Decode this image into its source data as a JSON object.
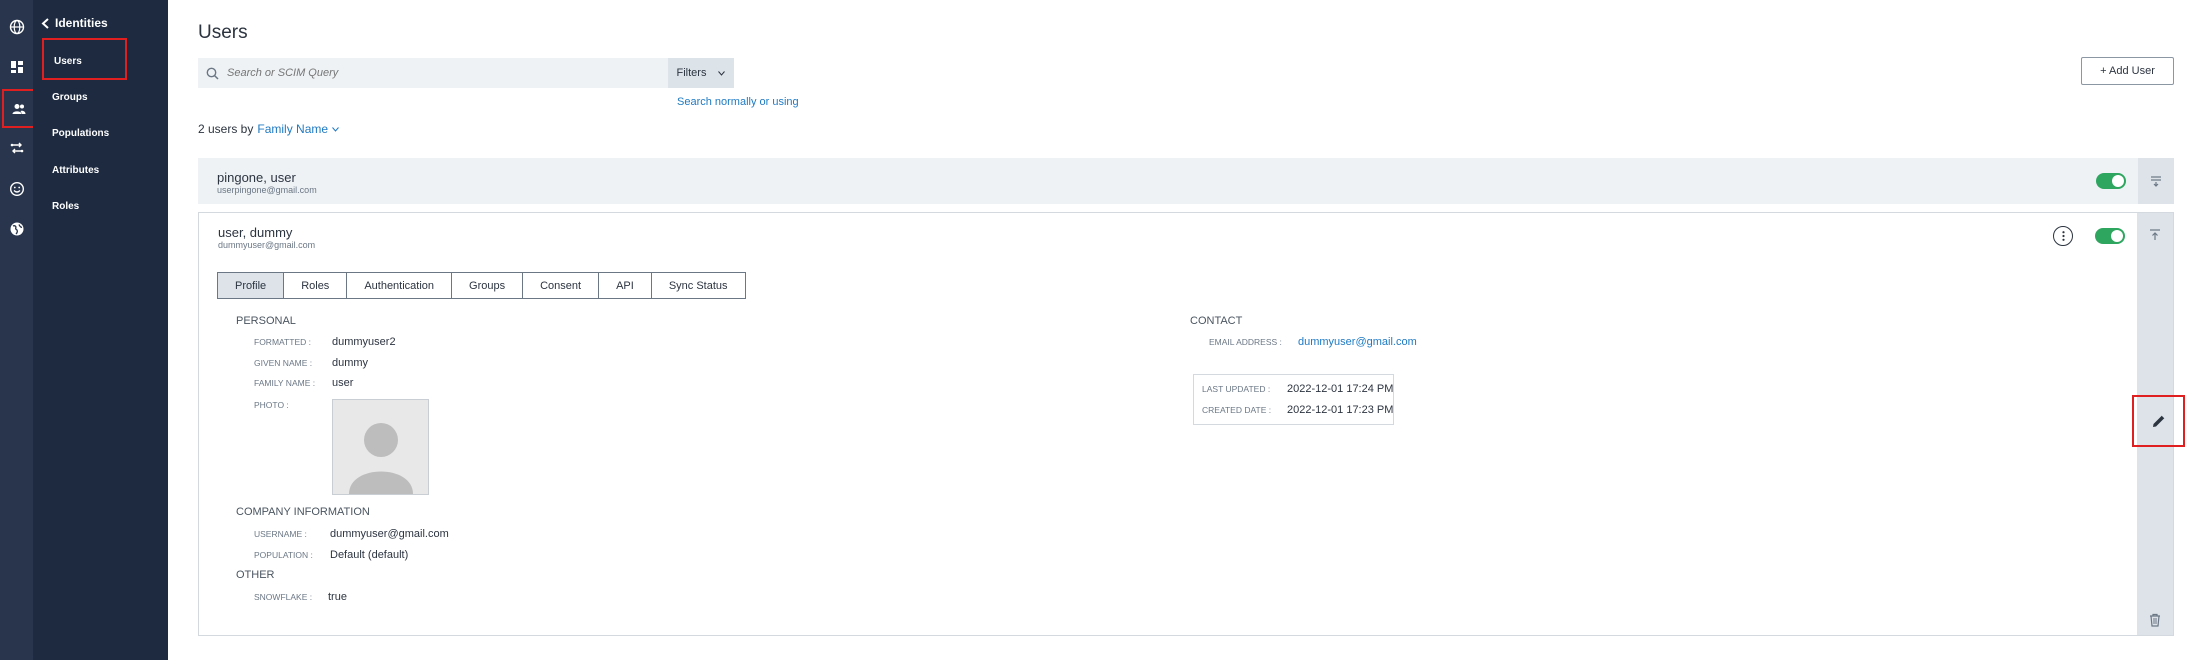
{
  "rail": {
    "icons": [
      "globe-icon",
      "dashboard-icon",
      "users-icon",
      "connections-icon",
      "experiences-icon",
      "settings-globe-icon"
    ]
  },
  "sidebar": {
    "back_label": "Identities",
    "items": [
      {
        "label": "Users"
      },
      {
        "label": "Groups"
      },
      {
        "label": "Populations"
      },
      {
        "label": "Attributes"
      },
      {
        "label": "Roles"
      }
    ]
  },
  "main": {
    "title": "Users",
    "search": {
      "placeholder": "Search or SCIM Query"
    },
    "filters_label": "Filters",
    "search_link": "Search normally or using",
    "add_user_label": "+ Add User",
    "count_text": "2 users by",
    "sort_label": "Family Name",
    "users": [
      {
        "name": "pingone, user",
        "email": "userpingone@gmail.com"
      },
      {
        "name": "user, dummy",
        "email": "dummyuser@gmail.com"
      }
    ],
    "tabs": [
      "Profile",
      "Roles",
      "Authentication",
      "Groups",
      "Consent",
      "API",
      "Sync Status"
    ],
    "profile": {
      "personal_heading": "PERSONAL",
      "formatted_label": "FORMATTED :",
      "formatted_value": "dummyuser2",
      "given_label": "GIVEN NAME :",
      "given_value": "dummy",
      "family_label": "FAMILY NAME :",
      "family_value": "user",
      "photo_label": "PHOTO :",
      "company_heading": "COMPANY INFORMATION",
      "username_label": "USERNAME :",
      "username_value": "dummyuser@gmail.com",
      "population_label": "POPULATION :",
      "population_value": "Default (default)",
      "other_heading": "OTHER",
      "snowflake_label": "SNOWFLAKE :",
      "snowflake_value": "true",
      "contact_heading": "CONTACT",
      "email_label": "EMAIL ADDRESS :",
      "email_value": "dummyuser@gmail.com",
      "updated_label": "LAST UPDATED :",
      "updated_value": "2022-12-01 17:24 PM",
      "created_label": "CREATED DATE :",
      "created_value": "2022-12-01 17:23 PM"
    }
  },
  "colors": {
    "rail_bg": "#28354c",
    "sidebar_bg": "#1d2a40",
    "accent_link": "#1f7ac3",
    "toggle_on": "#2ea660",
    "highlight_red": "#e02020"
  }
}
